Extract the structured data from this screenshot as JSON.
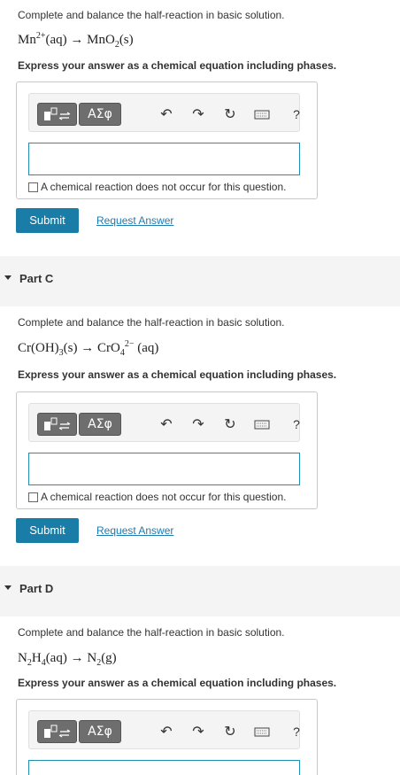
{
  "part_b": {
    "prompt": "Complete and balance the half-reaction in basic solution.",
    "eq_lhs": "Mn",
    "eq_lhs_sup": "2+",
    "eq_lhs_phase": "(aq)",
    "eq_arrow": "→",
    "eq_rhs": "MnO",
    "eq_rhs_sub": "2",
    "eq_rhs_phase": "(s)",
    "instruction": "Express your answer as a chemical equation including phases.",
    "greek_label": "ΑΣφ",
    "help_label": "?",
    "no_reaction_label": "A chemical reaction does not occur for this question.",
    "submit_label": "Submit",
    "request_label": "Request Answer"
  },
  "part_c": {
    "title": "Part C",
    "prompt": "Complete and balance the half-reaction in basic solution.",
    "eq_lhs": "Cr(OH)",
    "eq_lhs_sub": "3",
    "eq_lhs_phase": "(s)",
    "eq_arrow": "→",
    "eq_rhs": "CrO",
    "eq_rhs_sub": "4",
    "eq_rhs_sup": "2−",
    "eq_rhs_phase": "(aq)",
    "instruction": "Express your answer as a chemical equation including phases.",
    "greek_label": "ΑΣφ",
    "help_label": "?",
    "no_reaction_label": "A chemical reaction does not occur for this question.",
    "submit_label": "Submit",
    "request_label": "Request Answer"
  },
  "part_d": {
    "title": "Part D",
    "prompt": "Complete and balance the half-reaction in basic solution.",
    "eq_lhs": "N",
    "eq_lhs_sub1": "2",
    "eq_lhs_mid": "H",
    "eq_lhs_sub2": "4",
    "eq_lhs_phase": "(aq)",
    "eq_arrow": "→",
    "eq_rhs": "N",
    "eq_rhs_sub": "2",
    "eq_rhs_phase": "(g)",
    "instruction": "Express your answer as a chemical equation including phases.",
    "greek_label": "ΑΣφ",
    "help_label": "?"
  },
  "colors": {
    "submit_bg": "#1a7da8",
    "link": "#1e7bb0",
    "input_border": "#1f8fb3"
  }
}
